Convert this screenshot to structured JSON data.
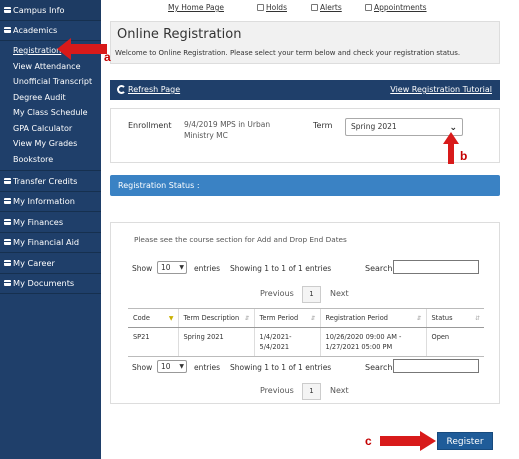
{
  "sidebar": {
    "campus_info": "Campus Info",
    "academics": "Academics",
    "academic_items": [
      "Registration",
      "View Attendance",
      "Unofficial Transcript",
      "Degree Audit",
      "My Class Schedule",
      "GPA Calculator",
      "View My Grades",
      "Bookstore"
    ],
    "sections": [
      "Transfer Credits",
      "My Information",
      "My Finances",
      "My Financial Aid",
      "My Career",
      "My Documents"
    ]
  },
  "toplinks": {
    "home": "My Home Page",
    "holds": "Holds",
    "alerts": "Alerts",
    "appointments": "Appointments"
  },
  "header": {
    "title": "Online Registration",
    "subtitle": "Welcome to Online Registration. Please select your term below and check your registration status."
  },
  "bar": {
    "refresh": "Refresh Page",
    "tutorial": "View Registration Tutorial"
  },
  "enrollment": {
    "label": "Enrollment",
    "value": "9/4/2019 MPS in Urban Ministry MC",
    "term_label": "Term",
    "term_selected": "Spring 2021"
  },
  "status": {
    "title": "Registration Status :"
  },
  "table_panel": {
    "note": "Please see the course section for Add and Drop End Dates",
    "show_label": "Show",
    "show_value": "10",
    "entries_label": "entries",
    "showing_text": "Showing 1 to 1 of 1 entries",
    "search_label": "Search",
    "previous": "Previous",
    "page": "1",
    "next": "Next",
    "columns": [
      "Code",
      "Term Description",
      "Term Period",
      "Registration Period",
      "Status"
    ],
    "rows": [
      [
        "SP21",
        "Spring 2021",
        "1/4/2021-5/4/2021",
        "10/26/2020 09:00 AM - 1/27/2021 05:00 PM",
        "Open"
      ]
    ]
  },
  "register_button": "Register",
  "annotations": {
    "a": "a",
    "b": "b",
    "c": "c",
    "color": "#d81a1a"
  }
}
